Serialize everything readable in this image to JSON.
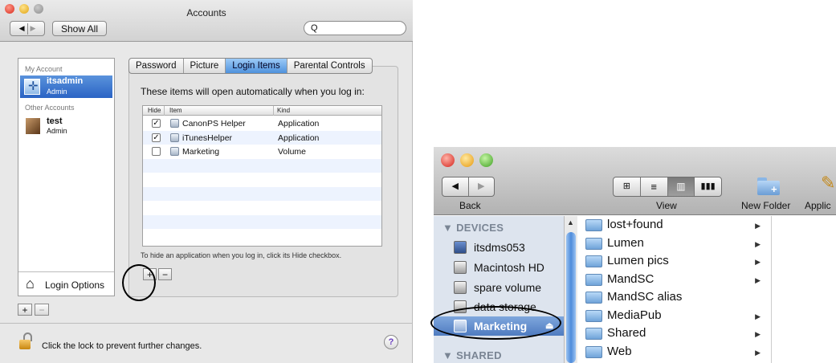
{
  "accounts_window": {
    "title": "Accounts",
    "show_all": "Show All",
    "search_placeholder": "Q",
    "sidebar": {
      "my_account_header": "My Account",
      "my_account": {
        "name": "itsadmin",
        "role": "Admin"
      },
      "other_header": "Other Accounts",
      "other": {
        "name": "test",
        "role": "Admin"
      },
      "login_options": "Login Options"
    },
    "tabs": [
      "Password",
      "Picture",
      "Login Items",
      "Parental Controls"
    ],
    "active_tab": "Login Items",
    "description": "These items will open automatically when you log in:",
    "table": {
      "headers": {
        "hide": "Hide",
        "item": "Item",
        "kind": "Kind"
      },
      "rows": [
        {
          "checked": true,
          "item": "CanonPS Helper",
          "kind": "Application"
        },
        {
          "checked": true,
          "item": "iTunesHelper",
          "kind": "Application"
        },
        {
          "checked": false,
          "item": "Marketing",
          "kind": "Volume"
        }
      ]
    },
    "hint": "To hide an application when you log in, click its Hide checkbox.",
    "add": "+",
    "remove": "−",
    "lock_text": "Click the lock to prevent further changes.",
    "help": "?"
  },
  "finder_window": {
    "toolbar": {
      "back": "Back",
      "view": "View",
      "new_folder": "New Folder",
      "applications_partial": "Applic"
    },
    "sidebar": {
      "devices_header": "▼ DEVICES",
      "devices": [
        "itsdms053",
        "Macintosh HD",
        "spare volume",
        "data storage",
        "Marketing"
      ],
      "selected": "Marketing",
      "shared_header": "▼ SHARED"
    },
    "folders": [
      {
        "name": "lost+found",
        "arrow": "▶"
      },
      {
        "name": "Lumen",
        "arrow": "▶"
      },
      {
        "name": "Lumen pics",
        "arrow": "▶"
      },
      {
        "name": "MandSC",
        "arrow": "▶"
      },
      {
        "name": "MandSC alias",
        "arrow": ""
      },
      {
        "name": "MediaPub",
        "arrow": "▶"
      },
      {
        "name": "Shared",
        "arrow": "▶"
      },
      {
        "name": "Web",
        "arrow": "▶"
      }
    ]
  },
  "colors": {
    "selection": "#2a63c4",
    "finder_sidebar": "#dde4ee",
    "folder": "#6fa3d9"
  }
}
